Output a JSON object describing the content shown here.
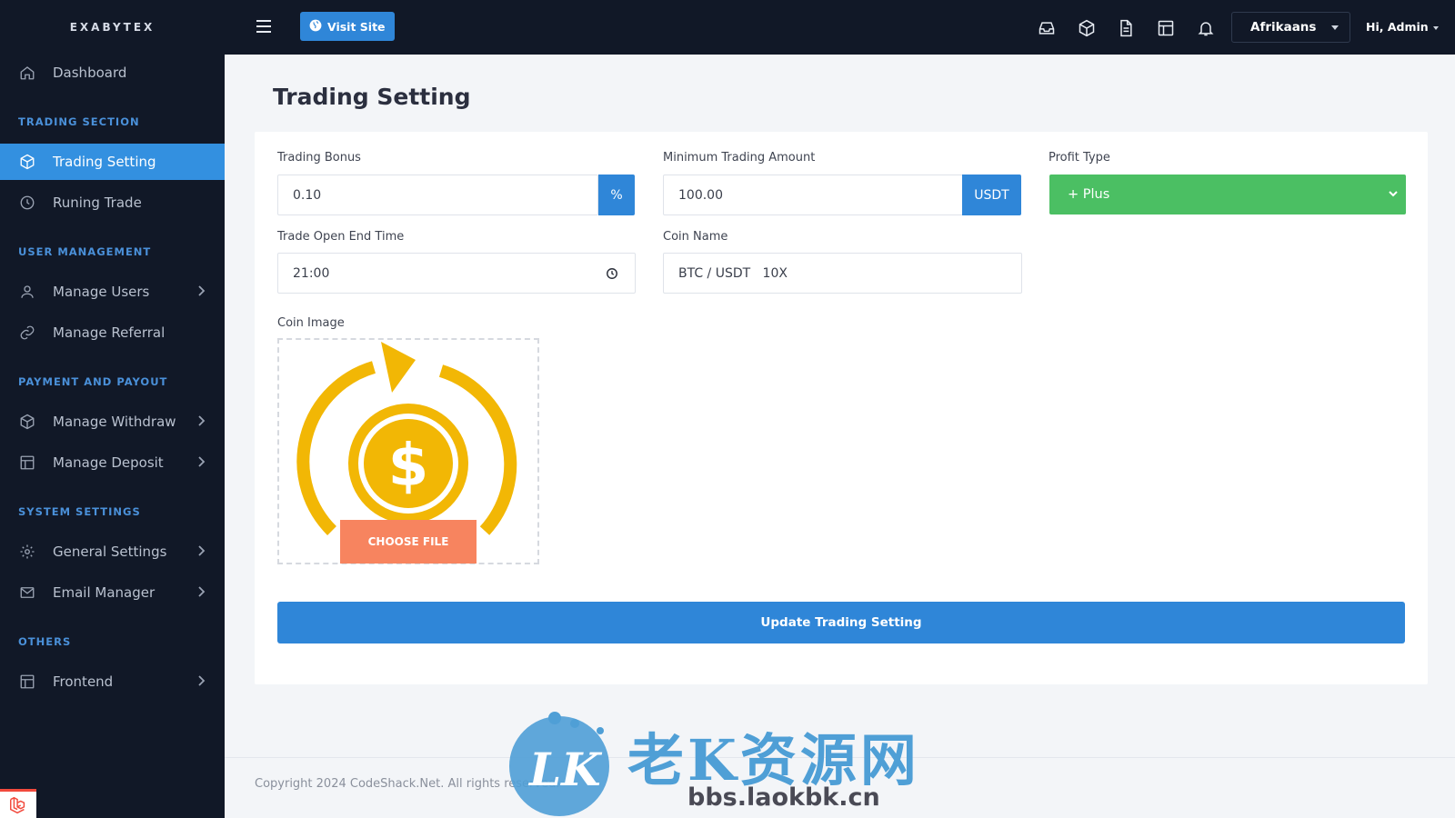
{
  "brand": "EXABYTEX",
  "sidebar": {
    "dashboard": "Dashboard",
    "sections": {
      "trading": "TRADING SECTION",
      "users": "USER MANAGEMENT",
      "payment": "PAYMENT AND PAYOUT",
      "system": "SYSTEM SETTINGS",
      "others": "OTHERS"
    },
    "items": {
      "trading_setting": "Trading Setting",
      "running_trade": "Runing Trade",
      "manage_users": "Manage Users",
      "manage_referral": "Manage Referral",
      "manage_withdraw": "Manage Withdraw",
      "manage_deposit": "Manage Deposit",
      "general_settings": "General Settings",
      "email_manager": "Email Manager",
      "frontend": "Frontend"
    }
  },
  "topbar": {
    "visit_site": "Visit Site",
    "language": "Afrikaans",
    "user": "Hi, Admin"
  },
  "page": {
    "title": "Trading Setting"
  },
  "form": {
    "trading_bonus": {
      "label": "Trading Bonus",
      "value": "0.10",
      "addon": "%"
    },
    "minimum_trading_amount": {
      "label": "Minimum Trading Amount",
      "value": "100.00",
      "addon": "USDT"
    },
    "profit_type": {
      "label": "Profit Type",
      "value": "+ Plus"
    },
    "trade_open_end_time": {
      "label": "Trade Open End Time",
      "value": "21:00"
    },
    "coin_name": {
      "label": "Coin Name",
      "value": "BTC / USDT   10X"
    },
    "coin_image": {
      "label": "Coin Image",
      "choose_file": "CHOOSE FILE"
    },
    "submit": "Update Trading Setting"
  },
  "footer": {
    "copyright": "Copyright 2024 CodeShack.Net. All rights reserved."
  },
  "watermark": {
    "title": "老K资源网",
    "url": "bbs.laokbk.cn"
  },
  "colors": {
    "sidebar_bg": "#111827",
    "accent": "#2f86d8",
    "profit_green": "#4bbf63",
    "choose_file": "#f7845f",
    "coin_gold": "#f2b705"
  }
}
